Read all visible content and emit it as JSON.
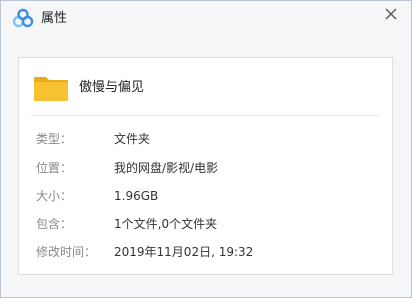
{
  "window": {
    "title": "属性"
  },
  "file": {
    "name": "傲慢与偏见",
    "icon": "folder-icon",
    "icon_color": "#f7c231"
  },
  "properties": [
    {
      "label": "类型：",
      "value": "文件夹"
    },
    {
      "label": "位置：",
      "value": "我的网盘/影视/电影"
    },
    {
      "label": "大小：",
      "value": "1.96GB"
    },
    {
      "label": "包含：",
      "value": "1个文件,0个文件夹"
    },
    {
      "label": "修改时间：",
      "value": "2019年11月02日, 19:32"
    }
  ],
  "colors": {
    "logo_blue": "#3e8be8",
    "logo_light_blue": "#7fc1f3",
    "label_gray": "#888888"
  }
}
